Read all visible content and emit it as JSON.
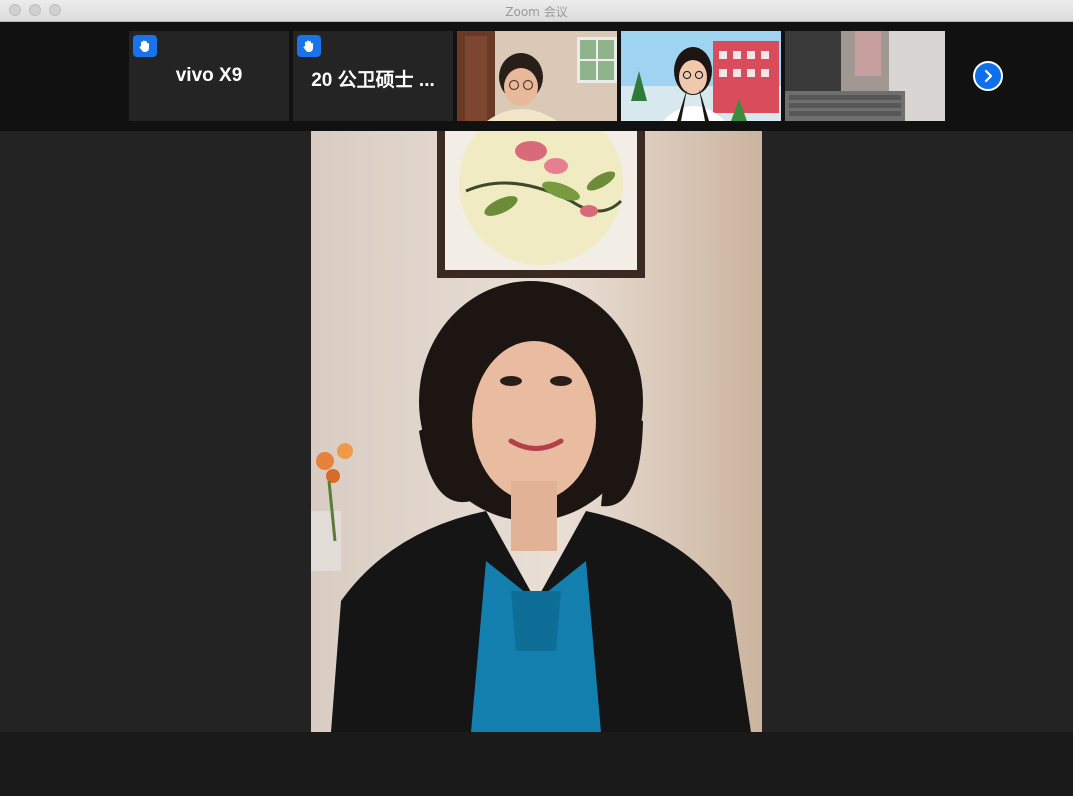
{
  "window": {
    "title": "Zoom 会议"
  },
  "participants_strip": {
    "tiles": [
      {
        "name": "vivo X9",
        "hand_raised": true
      },
      {
        "name": "20 公卫硕士 ...",
        "hand_raised": true
      },
      {
        "kind": "video"
      },
      {
        "kind": "video"
      },
      {
        "kind": "video"
      }
    ],
    "next_icon": "chevron-right-icon"
  },
  "active_speaker": {
    "kind": "video"
  },
  "colors": {
    "accent": "#0e71eb",
    "hand_badge": "#1a73e8",
    "background": "#232323"
  }
}
